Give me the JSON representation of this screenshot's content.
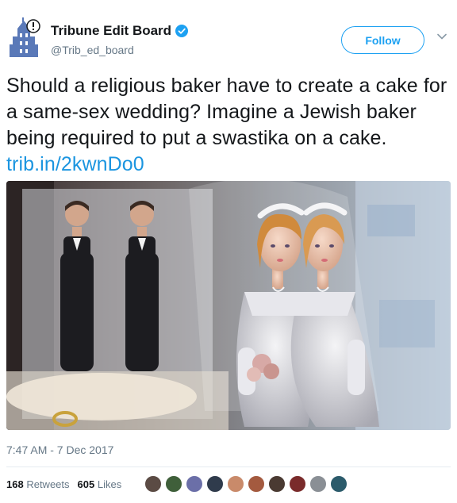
{
  "account": {
    "display_name": "Tribune Edit Board",
    "handle": "@Trib_ed_board",
    "verified": true,
    "avatar_icon": "tribune-logo-icon"
  },
  "follow": {
    "label": "Follow"
  },
  "menu": {
    "icon": "chevron-down-icon"
  },
  "tweet": {
    "text": "Should a religious baker have to create a cake for a same-sex wedding? Imagine a Jewish baker being required to put a swastika on a cake.",
    "link": "trib.in/2kwnDo0"
  },
  "media": {
    "icon": "photo-wedding-cake-toppers"
  },
  "timestamp": "7:47 AM - 7 Dec 2017",
  "stats": {
    "retweets_count": "168",
    "retweets_label": "Retweets",
    "likes_count": "605",
    "likes_label": "Likes"
  },
  "likers": {
    "count": 10
  },
  "colors": {
    "accent": "#1da1f2",
    "link": "#1b95e0",
    "text": "#14171a",
    "muted": "#657786"
  }
}
